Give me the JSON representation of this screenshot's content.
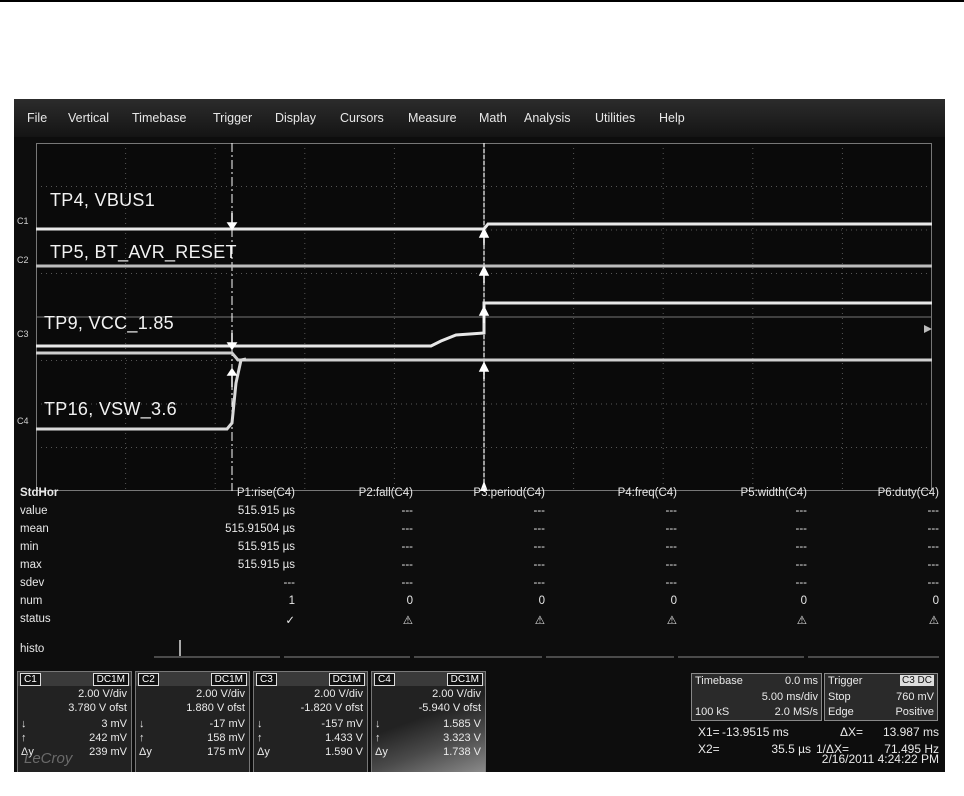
{
  "menu": [
    "File",
    "Vertical",
    "Timebase",
    "Trigger",
    "Display",
    "Cursors",
    "Measure",
    "Math",
    "Analysis",
    "Utilities",
    "Help"
  ],
  "channel_markers": [
    "C1",
    "C2",
    "C3",
    "C4"
  ],
  "traces": [
    {
      "label": "TP4, VBUS1"
    },
    {
      "label": "TP5, BT_AVR_RESET"
    },
    {
      "label": "TP9, VCC_1.85"
    },
    {
      "label": "TP16, VSW_3.6"
    }
  ],
  "measure": {
    "corner": "StdHor",
    "columns": [
      "P1:rise(C4)",
      "P2:fall(C4)",
      "P3:period(C4)",
      "P4:freq(C4)",
      "P5:width(C4)",
      "P6:duty(C4)"
    ],
    "rows": [
      {
        "label": "value",
        "cells": [
          "515.915 µs",
          "---",
          "---",
          "---",
          "---",
          "---"
        ]
      },
      {
        "label": "mean",
        "cells": [
          "515.91504 µs",
          "---",
          "---",
          "---",
          "---",
          "---"
        ]
      },
      {
        "label": "min",
        "cells": [
          "515.915 µs",
          "---",
          "---",
          "---",
          "---",
          "---"
        ]
      },
      {
        "label": "max",
        "cells": [
          "515.915 µs",
          "---",
          "---",
          "---",
          "---",
          "---"
        ]
      },
      {
        "label": "sdev",
        "cells": [
          "---",
          "---",
          "---",
          "---",
          "---",
          "---"
        ]
      },
      {
        "label": "num",
        "cells": [
          "1",
          "0",
          "0",
          "0",
          "0",
          "0"
        ]
      },
      {
        "label": "status",
        "cells": [
          "✓",
          "⚠",
          "⚠",
          "⚠",
          "⚠",
          "⚠"
        ]
      }
    ],
    "histo": "histo"
  },
  "channels": [
    {
      "name": "C1",
      "coupling": "DC1M",
      "vdiv": "2.00 V/div",
      "ofst": "3.780 V ofst",
      "down": "3 mV",
      "up": "242 mV",
      "dy": "239 mV"
    },
    {
      "name": "C2",
      "coupling": "DC1M",
      "vdiv": "2.00 V/div",
      "ofst": "1.880 V ofst",
      "down": "-17 mV",
      "up": "158 mV",
      "dy": "175 mV"
    },
    {
      "name": "C3",
      "coupling": "DC1M",
      "vdiv": "2.00 V/div",
      "ofst": "-1.820 V ofst",
      "down": "-157 mV",
      "up": "1.433 V",
      "dy": "1.590 V"
    },
    {
      "name": "C4",
      "coupling": "DC1M",
      "vdiv": "2.00 V/div",
      "ofst": "-5.940 V ofst",
      "down": "1.585 V",
      "up": "3.323 V",
      "dy": "1.738 V"
    }
  ],
  "symbols": {
    "down": "↓",
    "up": "↑",
    "dy": "Δy"
  },
  "timebase": {
    "label": "Timebase",
    "delay": "0.0 ms",
    "rate": "5.00 ms/div",
    "samples": "100 kS",
    "sample_rate": "2.0 MS/s"
  },
  "trigger": {
    "label": "Trigger",
    "badge": "C3 DC",
    "mode": "Stop",
    "level": "760 mV",
    "type": "Edge",
    "slope": "Positive"
  },
  "cursors": {
    "x1_label": "X1=",
    "x1": "-13.9515 ms",
    "dx_label": "ΔX=",
    "dx": "13.987 ms",
    "x2_label": "X2=",
    "x2": "35.5 µs",
    "inv_label": "1/ΔX=",
    "inv": "71.495 Hz"
  },
  "brand": "LeCroy",
  "datetime": "2/16/2011 4:24:22 PM",
  "colors": {
    "trace": "#e8e8e8",
    "background": "#0d0d0d",
    "grid": "#555555"
  }
}
